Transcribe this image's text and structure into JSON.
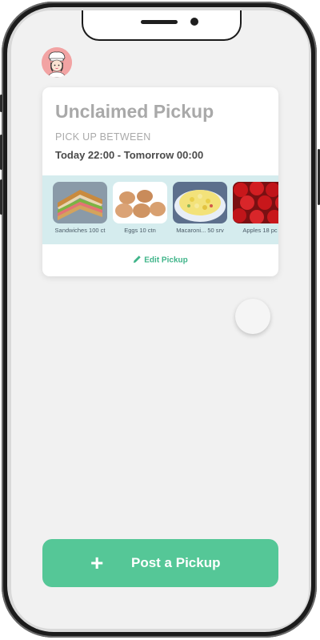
{
  "card": {
    "title": "Unclaimed Pickup",
    "pickup_label": "PICK UP BETWEEN",
    "pickup_time": "Today 22:00 - Tomorrow 00:00",
    "edit_label": "Edit Pickup"
  },
  "foods": [
    {
      "label": "Sandwiches 100 ct",
      "icon": "sandwich-image"
    },
    {
      "label": "Eggs 10 ctn",
      "icon": "eggs-image"
    },
    {
      "label": "Macaroni... 50 srv",
      "icon": "macaroni-image"
    },
    {
      "label": "Apples 18 pc",
      "icon": "apples-image"
    }
  ],
  "post_button": {
    "label": "Post a Pickup",
    "icon": "plus-icon"
  },
  "colors": {
    "accent": "#55c797",
    "strip": "#d5ecee",
    "background": "#f1f1f1"
  }
}
